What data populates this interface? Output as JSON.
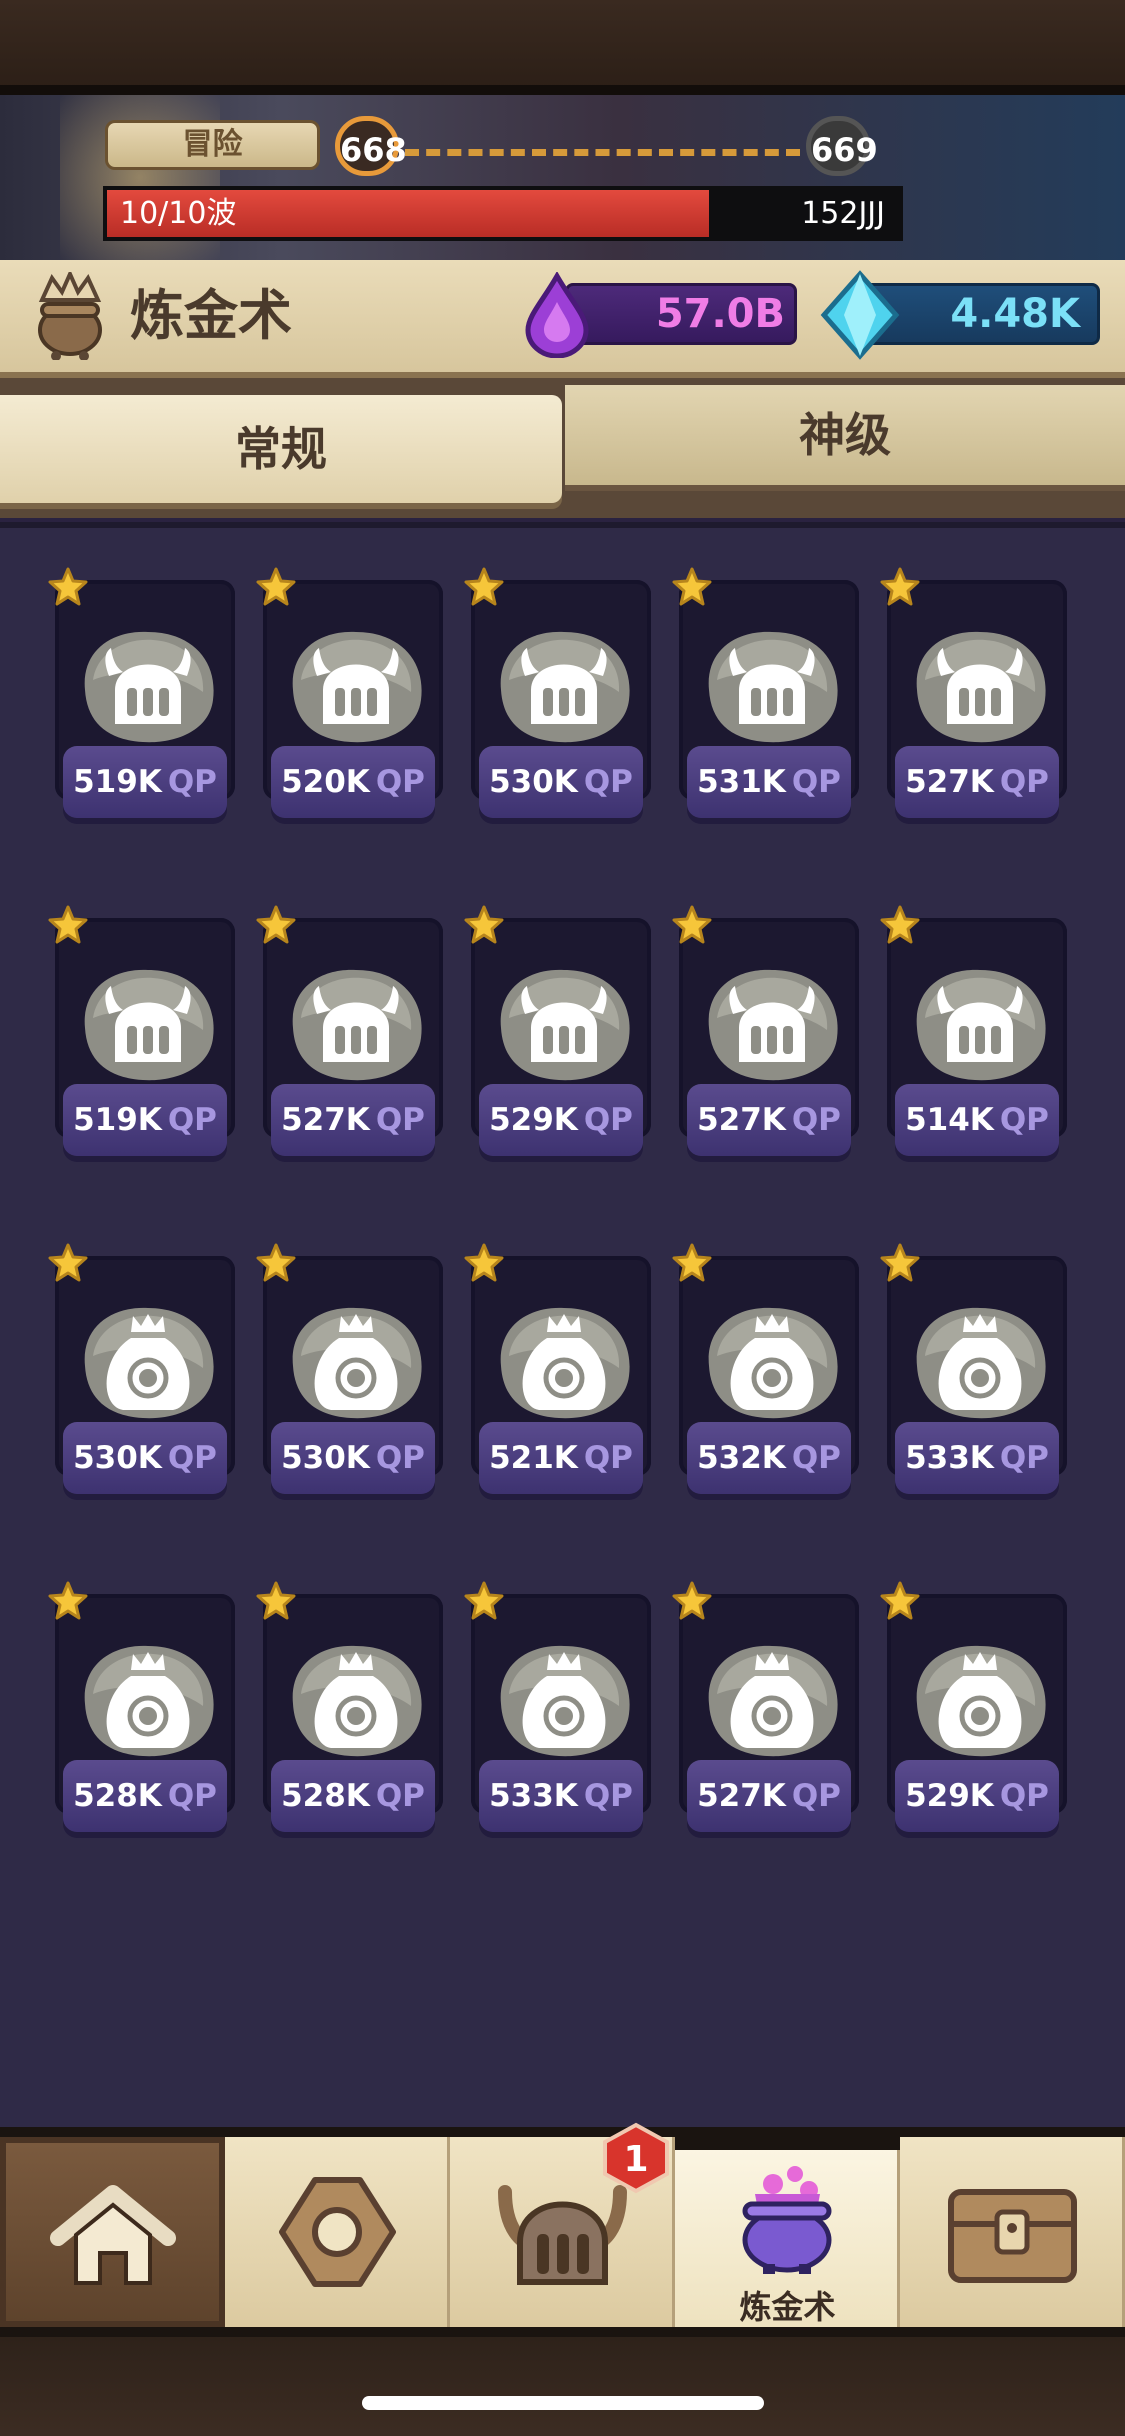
{
  "progress": {
    "mode_label": "冒险",
    "current_level": "668",
    "next_level": "669",
    "wave_text": "10/10波",
    "enemy_hp": "152JJJ",
    "wave_fill_fraction": 0.76
  },
  "header": {
    "title": "炼金术",
    "elixir": "57.0B",
    "gems": "4.48K"
  },
  "tabs": [
    "常规",
    "神级"
  ],
  "grid": {
    "unit": "QP",
    "items": [
      {
        "value": "519K",
        "type": "helmet"
      },
      {
        "value": "520K",
        "type": "helmet"
      },
      {
        "value": "530K",
        "type": "helmet"
      },
      {
        "value": "531K",
        "type": "helmet"
      },
      {
        "value": "527K",
        "type": "helmet"
      },
      {
        "value": "519K",
        "type": "helmet"
      },
      {
        "value": "527K",
        "type": "helmet"
      },
      {
        "value": "529K",
        "type": "helmet"
      },
      {
        "value": "527K",
        "type": "helmet"
      },
      {
        "value": "514K",
        "type": "helmet"
      },
      {
        "value": "530K",
        "type": "bag"
      },
      {
        "value": "530K",
        "type": "bag"
      },
      {
        "value": "521K",
        "type": "bag"
      },
      {
        "value": "532K",
        "type": "bag"
      },
      {
        "value": "533K",
        "type": "bag"
      },
      {
        "value": "528K",
        "type": "bag"
      },
      {
        "value": "528K",
        "type": "bag"
      },
      {
        "value": "533K",
        "type": "bag"
      },
      {
        "value": "527K",
        "type": "bag"
      },
      {
        "value": "529K",
        "type": "bag"
      }
    ]
  },
  "nav": {
    "items": [
      "home-icon",
      "gear-icon",
      "hero-helmet-icon",
      "alchemy-cauldron-icon",
      "chest-icon"
    ],
    "active_label": "炼金术",
    "hero_badge": "1"
  },
  "colors": {
    "grid_bg": "#2f2a47",
    "elixir_text": "#f07de6",
    "gem_text": "#7be0f7",
    "wave_bar": "#d9392f"
  }
}
